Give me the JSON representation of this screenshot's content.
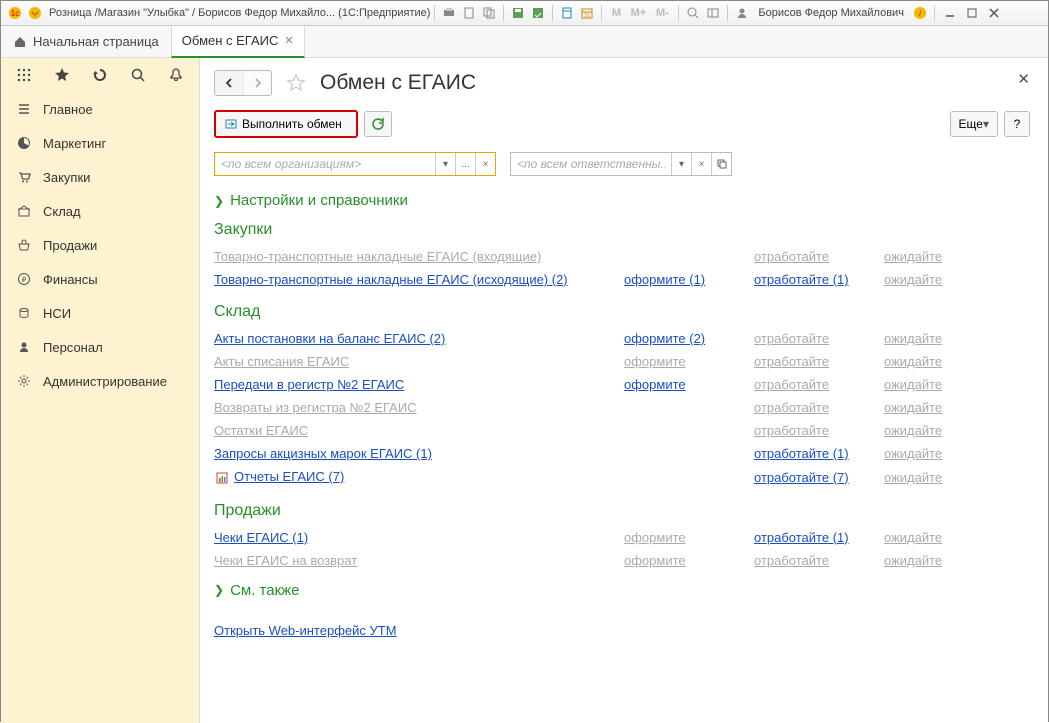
{
  "titlebar": {
    "app_title": "Розница /Магазин \"Улыбка\" / Борисов Федор Михайло... (1С:Предприятие)",
    "user": "Борисов Федор Михайлович",
    "m1": "M",
    "m2": "M+",
    "m3": "M-"
  },
  "tabs": {
    "home": "Начальная страница",
    "active": "Обмен с ЕГАИС"
  },
  "sidebar": {
    "items": [
      {
        "label": "Главное"
      },
      {
        "label": "Маркетинг"
      },
      {
        "label": "Закупки"
      },
      {
        "label": "Склад"
      },
      {
        "label": "Продажи"
      },
      {
        "label": "Финансы"
      },
      {
        "label": "НСИ"
      },
      {
        "label": "Персонал"
      },
      {
        "label": "Администрирование"
      }
    ]
  },
  "page": {
    "title": "Обмен с ЕГАИС",
    "btn_exec": "Выполнить обмен",
    "btn_more": "Еще",
    "btn_help": "?",
    "filter1_placeholder": "по всем организациям",
    "filter2_placeholder": "по всем ответственны...",
    "expand1": "Настройки и справочники",
    "expand2": "См. также",
    "link_utm": "Открыть Web-интерфейс УТМ",
    "sections": {
      "zakupki": {
        "title": "Закупки",
        "rows": [
          {
            "c1": "Товарно-транспортные накладные ЕГАИС (входящие)",
            "c1dis": true,
            "c2": "",
            "c3": "отработайте",
            "c3dis": true,
            "c4": "ожидайте",
            "c4dis": true
          },
          {
            "c1": "Товарно-транспортные накладные ЕГАИС (исходящие) (2)",
            "c2": "оформите (1)",
            "c3": "отработайте (1)",
            "c4": "ожидайте",
            "c4dis": true
          }
        ]
      },
      "sklad": {
        "title": "Склад",
        "rows": [
          {
            "c1": "Акты постановки на баланс ЕГАИС (2)",
            "c2": "оформите (2)",
            "c3": "отработайте",
            "c3dis": true,
            "c4": "ожидайте",
            "c4dis": true
          },
          {
            "c1": "Акты списания ЕГАИС",
            "c1dis": true,
            "c2": "оформите",
            "c2dis": true,
            "c3": "отработайте",
            "c3dis": true,
            "c4": "ожидайте",
            "c4dis": true
          },
          {
            "c1": "Передачи в регистр №2 ЕГАИС",
            "c2": "оформите",
            "c3": "отработайте",
            "c3dis": true,
            "c4": "ожидайте",
            "c4dis": true
          },
          {
            "c1": "Возвраты из регистра №2 ЕГАИС",
            "c1dis": true,
            "c2": "",
            "c3": "отработайте",
            "c3dis": true,
            "c4": "ожидайте",
            "c4dis": true
          },
          {
            "c1": "Остатки ЕГАИС",
            "c1dis": true,
            "c2": "",
            "c3": "отработайте",
            "c3dis": true,
            "c4": "ожидайте",
            "c4dis": true
          },
          {
            "c1": "Запросы акцизных марок ЕГАИС (1)",
            "c2": "",
            "c3": "отработайте (1)",
            "c4": "ожидайте",
            "c4dis": true
          },
          {
            "c1": "Отчеты ЕГАИС (7)",
            "icon": true,
            "c2": "",
            "c3": "отработайте (7)",
            "c4": "ожидайте",
            "c4dis": true
          }
        ]
      },
      "prodazhi": {
        "title": "Продажи",
        "rows": [
          {
            "c1": "Чеки ЕГАИС (1)",
            "c2": "оформите",
            "c2dis": true,
            "c3": "отработайте (1)",
            "c4": "ожидайте",
            "c4dis": true
          },
          {
            "c1": "Чеки ЕГАИС на возврат",
            "c1dis": true,
            "c2": "оформите",
            "c2dis": true,
            "c3": "отработайте",
            "c3dis": true,
            "c4": "ожидайте",
            "c4dis": true
          }
        ]
      }
    }
  }
}
